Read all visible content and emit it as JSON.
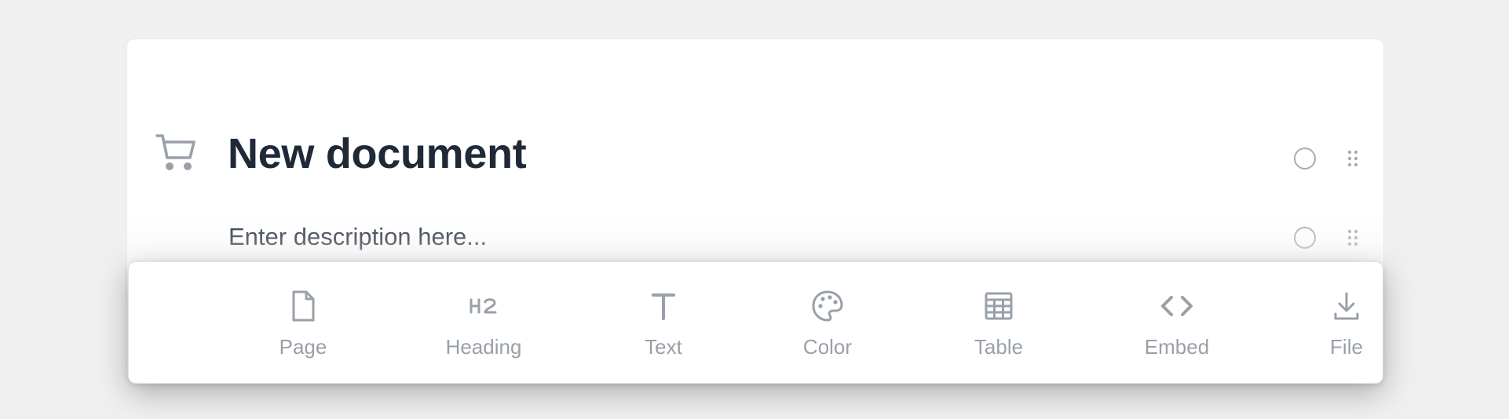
{
  "document": {
    "title": "New document",
    "description_placeholder": "Enter description here..."
  },
  "toolbar": {
    "items": [
      {
        "label": "Page",
        "icon": "page-icon"
      },
      {
        "label": "Heading",
        "icon": "h2-heading-icon"
      },
      {
        "label": "Text",
        "icon": "text-t-icon"
      },
      {
        "label": "Color",
        "icon": "palette-icon"
      },
      {
        "label": "Table",
        "icon": "table-grid-icon"
      },
      {
        "label": "Embed",
        "icon": "code-embed-icon"
      },
      {
        "label": "File",
        "icon": "download-file-icon"
      }
    ]
  },
  "colors": {
    "background": "#f0f0f0",
    "card": "#ffffff",
    "title_text": "#1f2937",
    "muted_icon": "#9aa0a8"
  }
}
